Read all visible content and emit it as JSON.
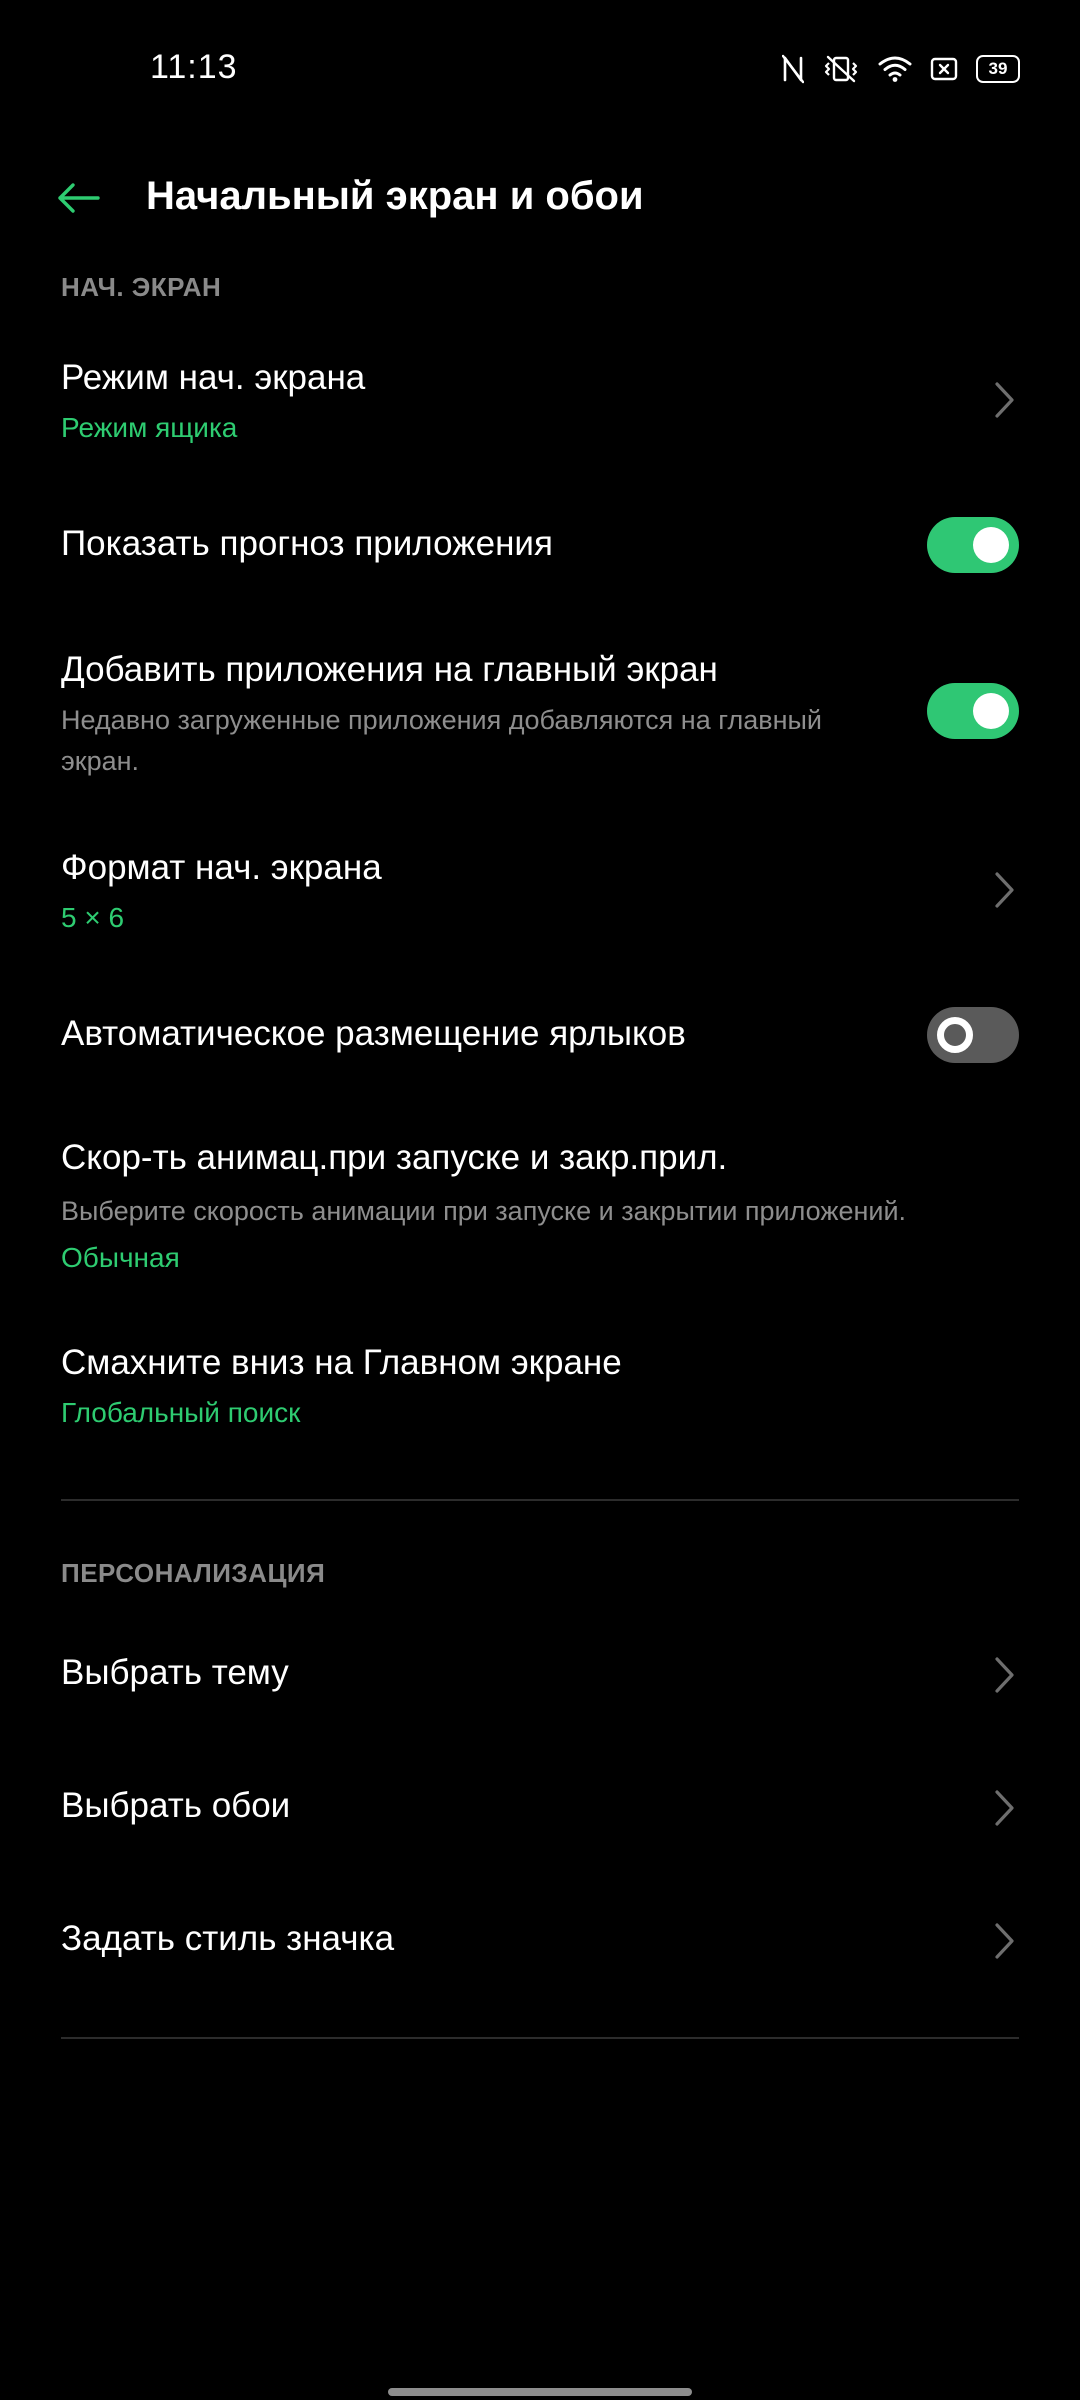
{
  "status_bar": {
    "time": "11:13",
    "battery": "39",
    "icons": [
      "nfc-icon",
      "vibrate-icon",
      "wifi-icon",
      "sim-off-icon",
      "battery-icon"
    ]
  },
  "header": {
    "back_icon": "arrow-left-icon",
    "title": "Начальный экран и обои"
  },
  "colors": {
    "accent": "#2ecc71",
    "toggle_on": "#2fc774",
    "toggle_off": "#5a5a5a",
    "secondary_text": "#8e8e8e",
    "section_header": "#8a8a8a"
  },
  "home_screen_section": {
    "header": "НАЧ. ЭКРАН",
    "home_mode": {
      "title": "Режим нач. экрана",
      "value": "Режим ящика"
    },
    "app_suggestions": {
      "title": "Показать прогноз приложения",
      "enabled": true
    },
    "add_apps": {
      "title": "Добавить приложения на главный экран",
      "description": "Недавно загруженные приложения добавляются на главный экран.",
      "enabled": true
    },
    "layout": {
      "title": "Формат нач. экрана",
      "value": "5 × 6"
    },
    "auto_arrange": {
      "title": "Автоматическое размещение ярлыков",
      "enabled": false
    },
    "animation_speed": {
      "title": "Скор-ть анимац.при запуске и закр.прил.",
      "description": "Выберите скорость анимации при запуске и закрытии приложений.",
      "value": "Обычная"
    },
    "swipe_down": {
      "title": "Смахните вниз на Главном экране",
      "value": "Глобальный поиск"
    }
  },
  "personalization_section": {
    "header": "ПЕРСОНАЛИЗАЦИЯ",
    "items": [
      {
        "label": "Выбрать тему"
      },
      {
        "label": "Выбрать обои"
      },
      {
        "label": "Задать стиль значка"
      }
    ]
  }
}
